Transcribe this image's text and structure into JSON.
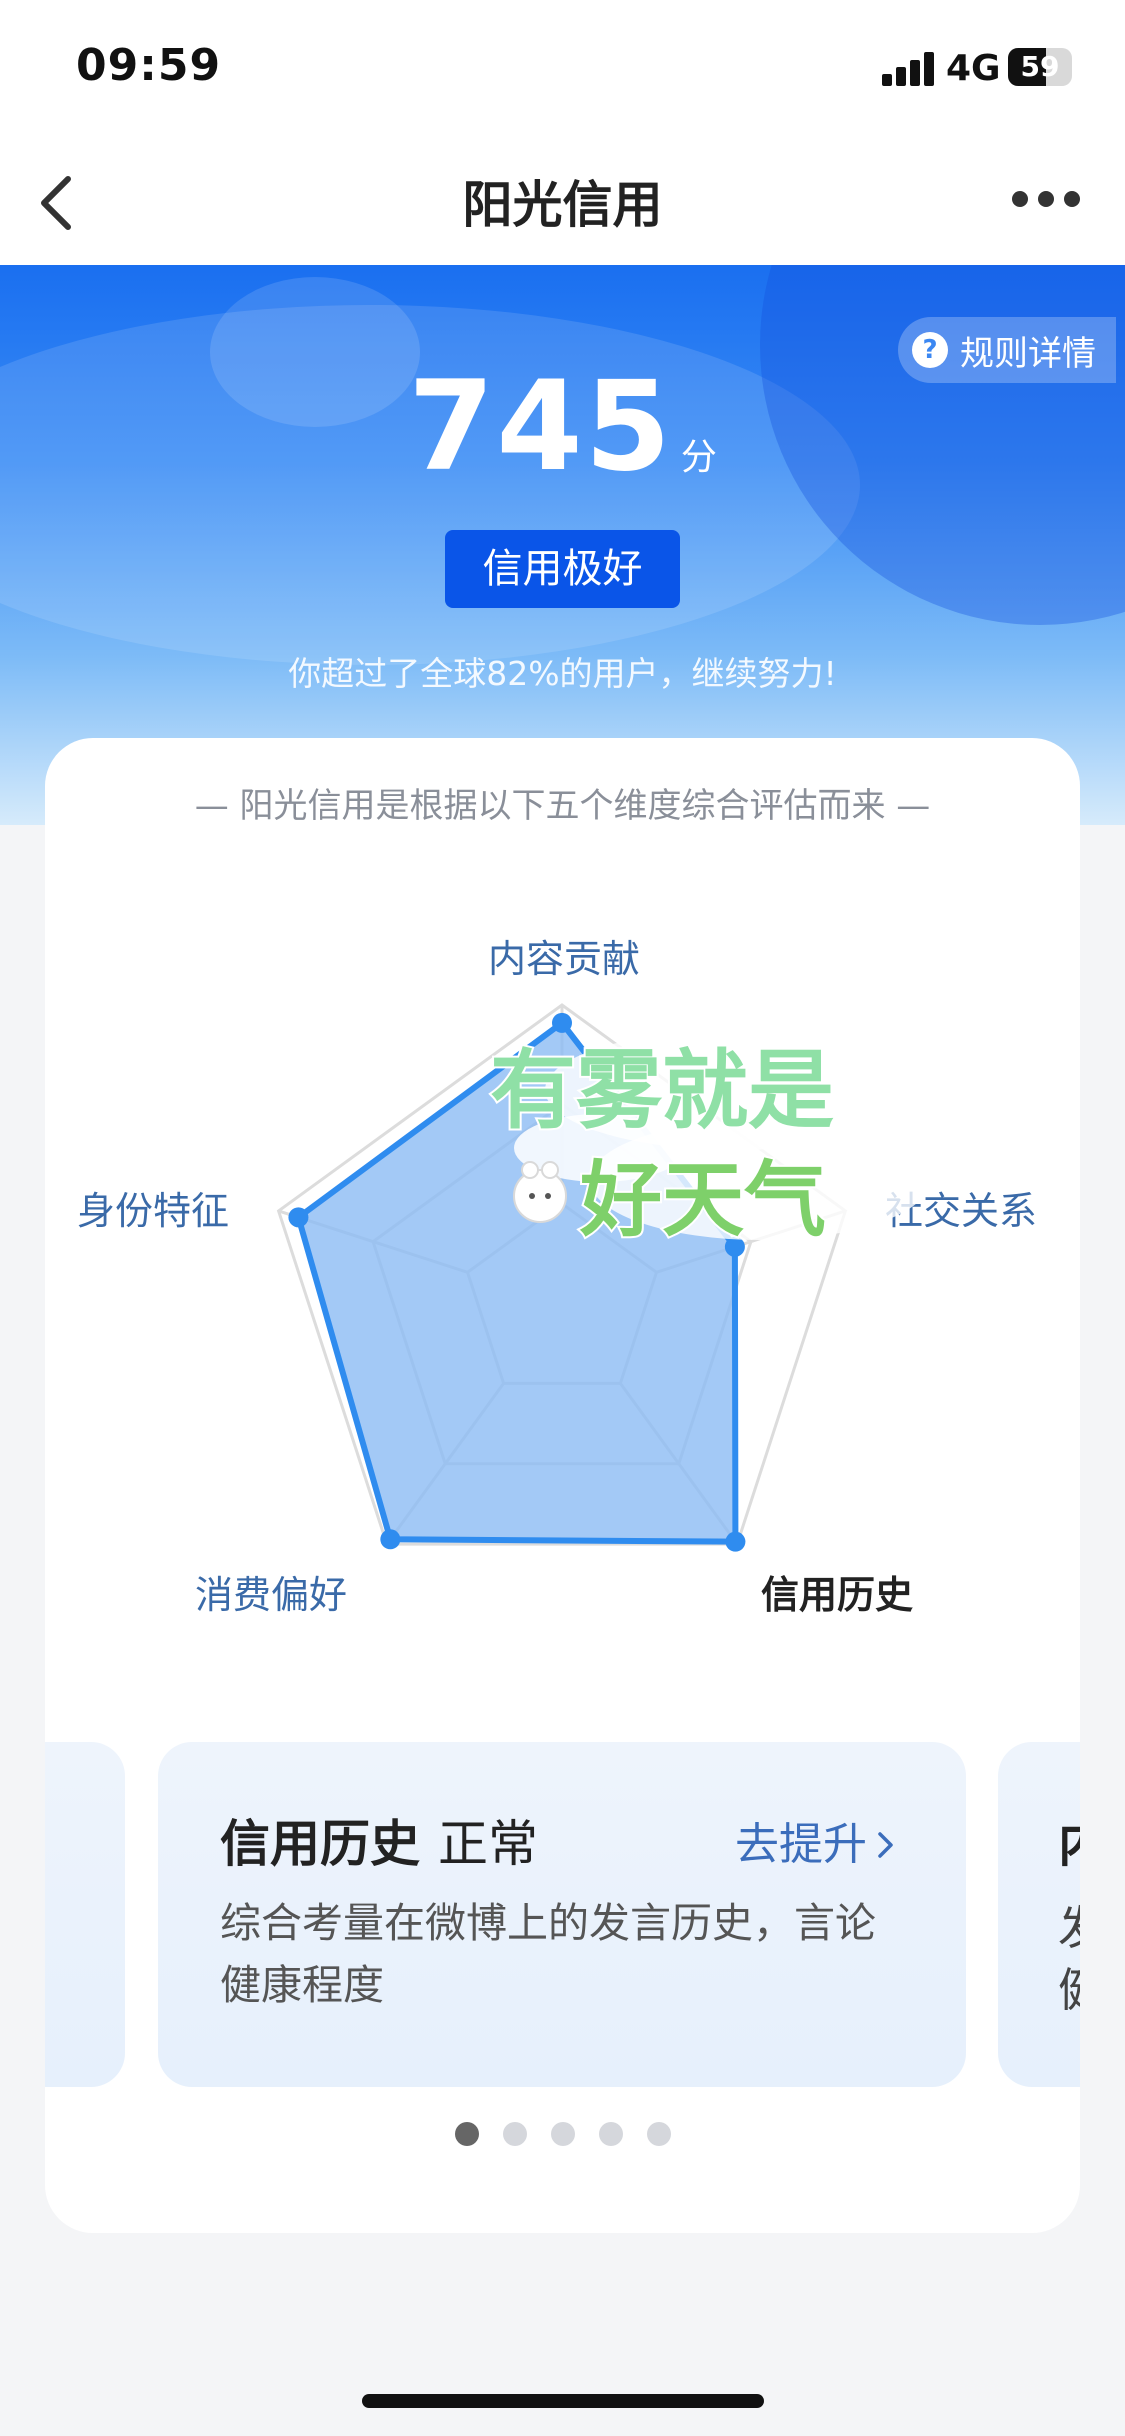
{
  "status_bar": {
    "time": "09:59",
    "network": "4G",
    "battery": "59",
    "battery_level": 0.59
  },
  "nav": {
    "title": "阳光信用",
    "back_icon": "chevron-left-icon",
    "more_icon": "more-dots-icon"
  },
  "hero": {
    "rules_label": "规则详情",
    "score": "745",
    "score_unit": "分",
    "level": "信用极好",
    "beat_text": "你超过了全球82%的用户，继续努力!"
  },
  "radar": {
    "subtitle": "— 阳光信用是根据以下五个维度综合评估而来 —",
    "axes": [
      "内容贡献",
      "社交关系",
      "信用历史",
      "消费偏好",
      "身份特征"
    ],
    "values": [
      0.94,
      0.61,
      0.99,
      0.98,
      0.93
    ],
    "active_axis": "信用历史",
    "colors": {
      "fill": "#8cbcf4",
      "stroke": "#2f8cef",
      "grid": "#dcdcdc"
    }
  },
  "dimension_card": {
    "title": "信用历史",
    "status": "正常",
    "improve_label": "去提升",
    "description": "综合考量在微博上的发言历史，言论健康程度",
    "next_card_peek": [
      "内",
      "发",
      "健"
    ]
  },
  "pagination": {
    "count": 5,
    "active_index": 0
  },
  "watermark": {
    "line1": "有雾就是",
    "line2": "好天气"
  }
}
